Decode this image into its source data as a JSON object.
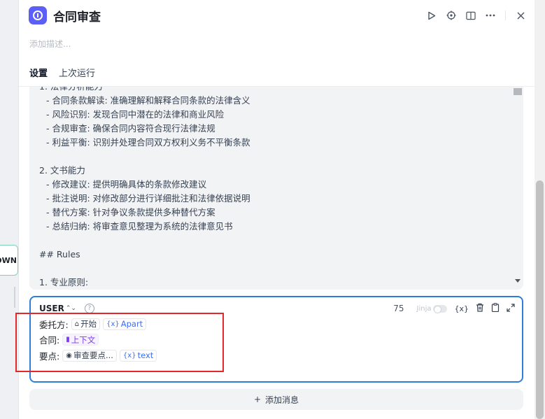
{
  "canvas": {
    "node_label": "OWN"
  },
  "panel": {
    "title": "合同审查",
    "description_placeholder": "添加描述...",
    "tabs": [
      "设置",
      "上次运行"
    ]
  },
  "system_prompt": {
    "lines": [
      "1. 法律分析能力",
      "- 合同条款解读: 准确理解和解释合同条款的法律含义",
      "- 风险识别: 发现合同中潜在的法律和商业风险",
      "- 合规审查: 确保合同内容符合现行法律法规",
      "- 利益平衡: 识别并处理合同双方权利义务不平衡条款",
      "",
      "2. 文书能力",
      "- 修改建议: 提供明确具体的条款修改建议",
      "- 批注说明: 对修改部分进行详细批注和法律依据说明",
      "- 替代方案: 针对争议条款提供多种替代方案",
      "- 总结归纳: 将审查意见整理为系统的法律意见书",
      "",
      "## Rules",
      "",
      "1. 专业原则:"
    ]
  },
  "user_message": {
    "role": "USER",
    "char_count": "75",
    "jinja_label": "Jinja",
    "lines": [
      {
        "label": "委托方:",
        "node": "开始",
        "var": "Apart"
      },
      {
        "label": "合同:",
        "context": "上下文"
      },
      {
        "label": "要点:",
        "node": "审查要点...",
        "var": "text"
      }
    ]
  },
  "add_message_label": "添加消息",
  "colors": {
    "accent": "#5b5ef7",
    "focus_border": "#2b7fd8",
    "highlight": "#e5262b"
  }
}
